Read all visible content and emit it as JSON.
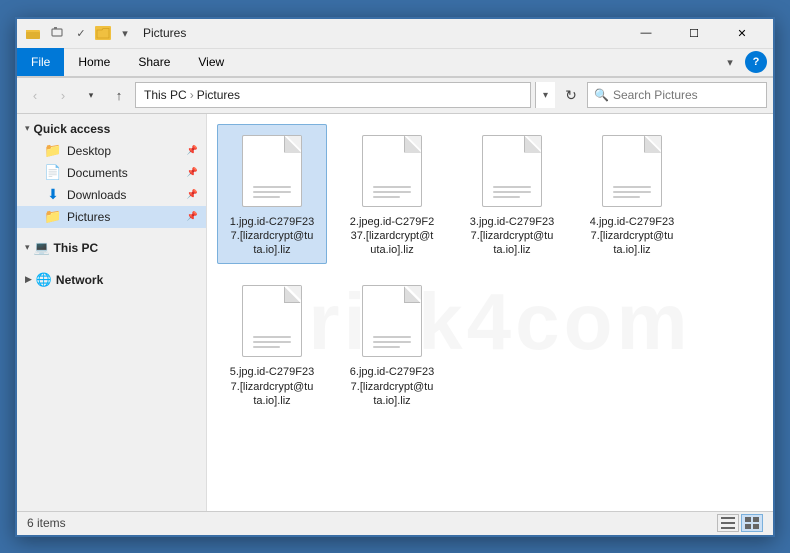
{
  "window": {
    "title": "Pictures",
    "icon": "folder"
  },
  "titleBar": {
    "quickAccess": [
      "undo",
      "redo",
      "dropdown"
    ],
    "controls": {
      "minimize": "—",
      "maximize": "☐",
      "close": "✕"
    }
  },
  "ribbon": {
    "tabs": [
      {
        "id": "file",
        "label": "File",
        "active": true
      },
      {
        "id": "home",
        "label": "Home",
        "active": false
      },
      {
        "id": "share",
        "label": "Share",
        "active": false
      },
      {
        "id": "view",
        "label": "View",
        "active": false
      }
    ]
  },
  "addressBar": {
    "back": "‹",
    "forward": "›",
    "up": "↑",
    "pathParts": [
      "This PC",
      "Pictures"
    ],
    "refresh": "↻",
    "searchPlaceholder": "Search Pictures"
  },
  "sidebar": {
    "quickAccessLabel": "Quick access",
    "items": [
      {
        "id": "desktop",
        "label": "Desktop",
        "icon": "folder-yellow",
        "pinned": true
      },
      {
        "id": "documents",
        "label": "Documents",
        "icon": "folder-yellow",
        "pinned": true
      },
      {
        "id": "downloads",
        "label": "Downloads",
        "icon": "folder-blue",
        "pinned": true
      },
      {
        "id": "pictures",
        "label": "Pictures",
        "icon": "folder-yellow",
        "pinned": true,
        "active": true
      }
    ],
    "thisPC": "This PC",
    "network": "Network"
  },
  "files": [
    {
      "id": 1,
      "name": "1.jpg.id-C279F23\n7.[lizardcrypt@tu\nta.io].liz",
      "selected": true
    },
    {
      "id": 2,
      "name": "2.jpeg.id-C279F2\n37.[lizardcrypt@t\nuta.io].liz",
      "selected": false
    },
    {
      "id": 3,
      "name": "3.jpg.id-C279F23\n7.[lizardcrypt@tu\nta.io].liz",
      "selected": false
    },
    {
      "id": 4,
      "name": "4.jpg.id-C279F23\n7.[lizardcrypt@tu\nta.io].liz",
      "selected": false
    },
    {
      "id": 5,
      "name": "5.jpg.id-C279F23\n7.[lizardcrypt@tu\nta.io].liz",
      "selected": false
    },
    {
      "id": 6,
      "name": "6.jpg.id-C279F23\n7.[lizardcrypt@tu\nta.io].liz",
      "selected": false
    }
  ],
  "statusBar": {
    "itemCount": "6 items",
    "viewGrid": "▦",
    "viewList": "▤"
  }
}
